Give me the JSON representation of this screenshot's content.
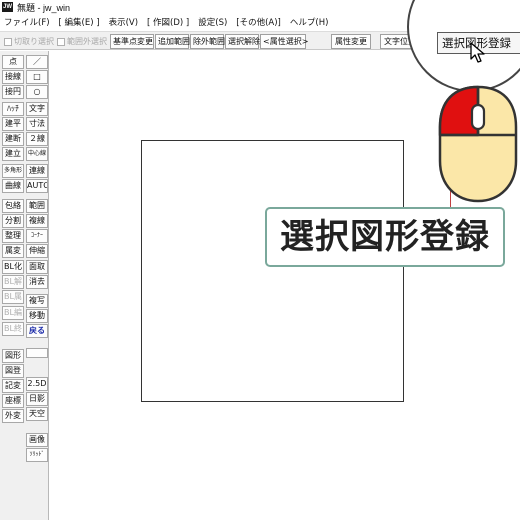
{
  "window": {
    "title": "無題 - jw_win",
    "app_icon_label": "JW"
  },
  "menubar": {
    "items": [
      "ファイル(F)",
      "[ 編集(E) ]",
      "表示(V)",
      "[ 作図(D) ]",
      "設定(S)",
      "[その他(A)]",
      "ヘルプ(H)"
    ]
  },
  "toolbar": {
    "cut_select_label": "切取り選択",
    "out_of_range_label": "範囲外選択",
    "base_point_change": "基準点変更",
    "add_range": "追加範囲",
    "exclude_range": "除外範囲",
    "deselect": "選択解除",
    "attr_select": "<属性選択>",
    "attr_change": "属性変更",
    "text_position": "文字位置",
    "register_selected_shape": "選択図形登録"
  },
  "left_tools": {
    "col1": [
      "点",
      "接線",
      "接円",
      "ﾊｯﾁ",
      "建平",
      "建断",
      "建立",
      "多角形",
      "曲線",
      "包絡",
      "分割",
      "整理",
      "属変",
      "BL化",
      "BL解",
      "BL属",
      "BL編",
      "BL終",
      "図形",
      "図登",
      "記変",
      "座標",
      "外変"
    ],
    "col2": [
      "／",
      "□",
      "○",
      "文字",
      "寸法",
      "２線",
      "中心線",
      "連線",
      "AUTO",
      "範囲",
      "複線",
      "ｺｰﾅｰ",
      "伸縮",
      "面取",
      "消去",
      "複写",
      "移動",
      "戻る",
      "2.5D",
      "日影",
      "天空",
      "画像",
      "ｿﾘｯﾄﾞ"
    ]
  },
  "zoom": {
    "button_label": "選択図形登録"
  },
  "caption": {
    "text": "選択図形登録"
  },
  "colors": {
    "mouse_left_button": "#e01010",
    "mouse_body": "#fbe7a8",
    "caption_border": "#7aa89b",
    "selection_red": "#c04040"
  }
}
